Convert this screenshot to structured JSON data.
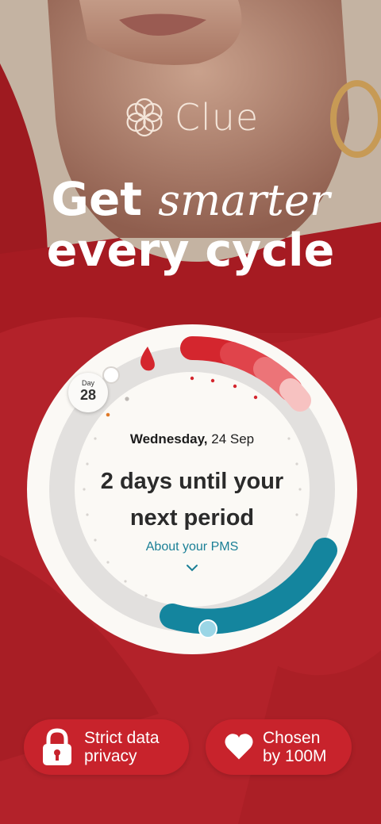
{
  "brand": {
    "name": "Clue"
  },
  "headline": {
    "line1_a": "Get",
    "line1_b": "smarter",
    "line2": "every cycle"
  },
  "cycle": {
    "day_label": "Day",
    "day_number": "28",
    "weekday": "Wednesday,",
    "date": "24 Sep",
    "message": "2 days until your next period",
    "link": "About your PMS"
  },
  "badges": [
    {
      "icon": "lock-icon",
      "label": "Strict data privacy"
    },
    {
      "icon": "heart-icon",
      "label": "Chosen by 100M"
    }
  ],
  "colors": {
    "accent_red": "#c8232c",
    "teal": "#14859e",
    "cream": "#f4e5d9"
  }
}
